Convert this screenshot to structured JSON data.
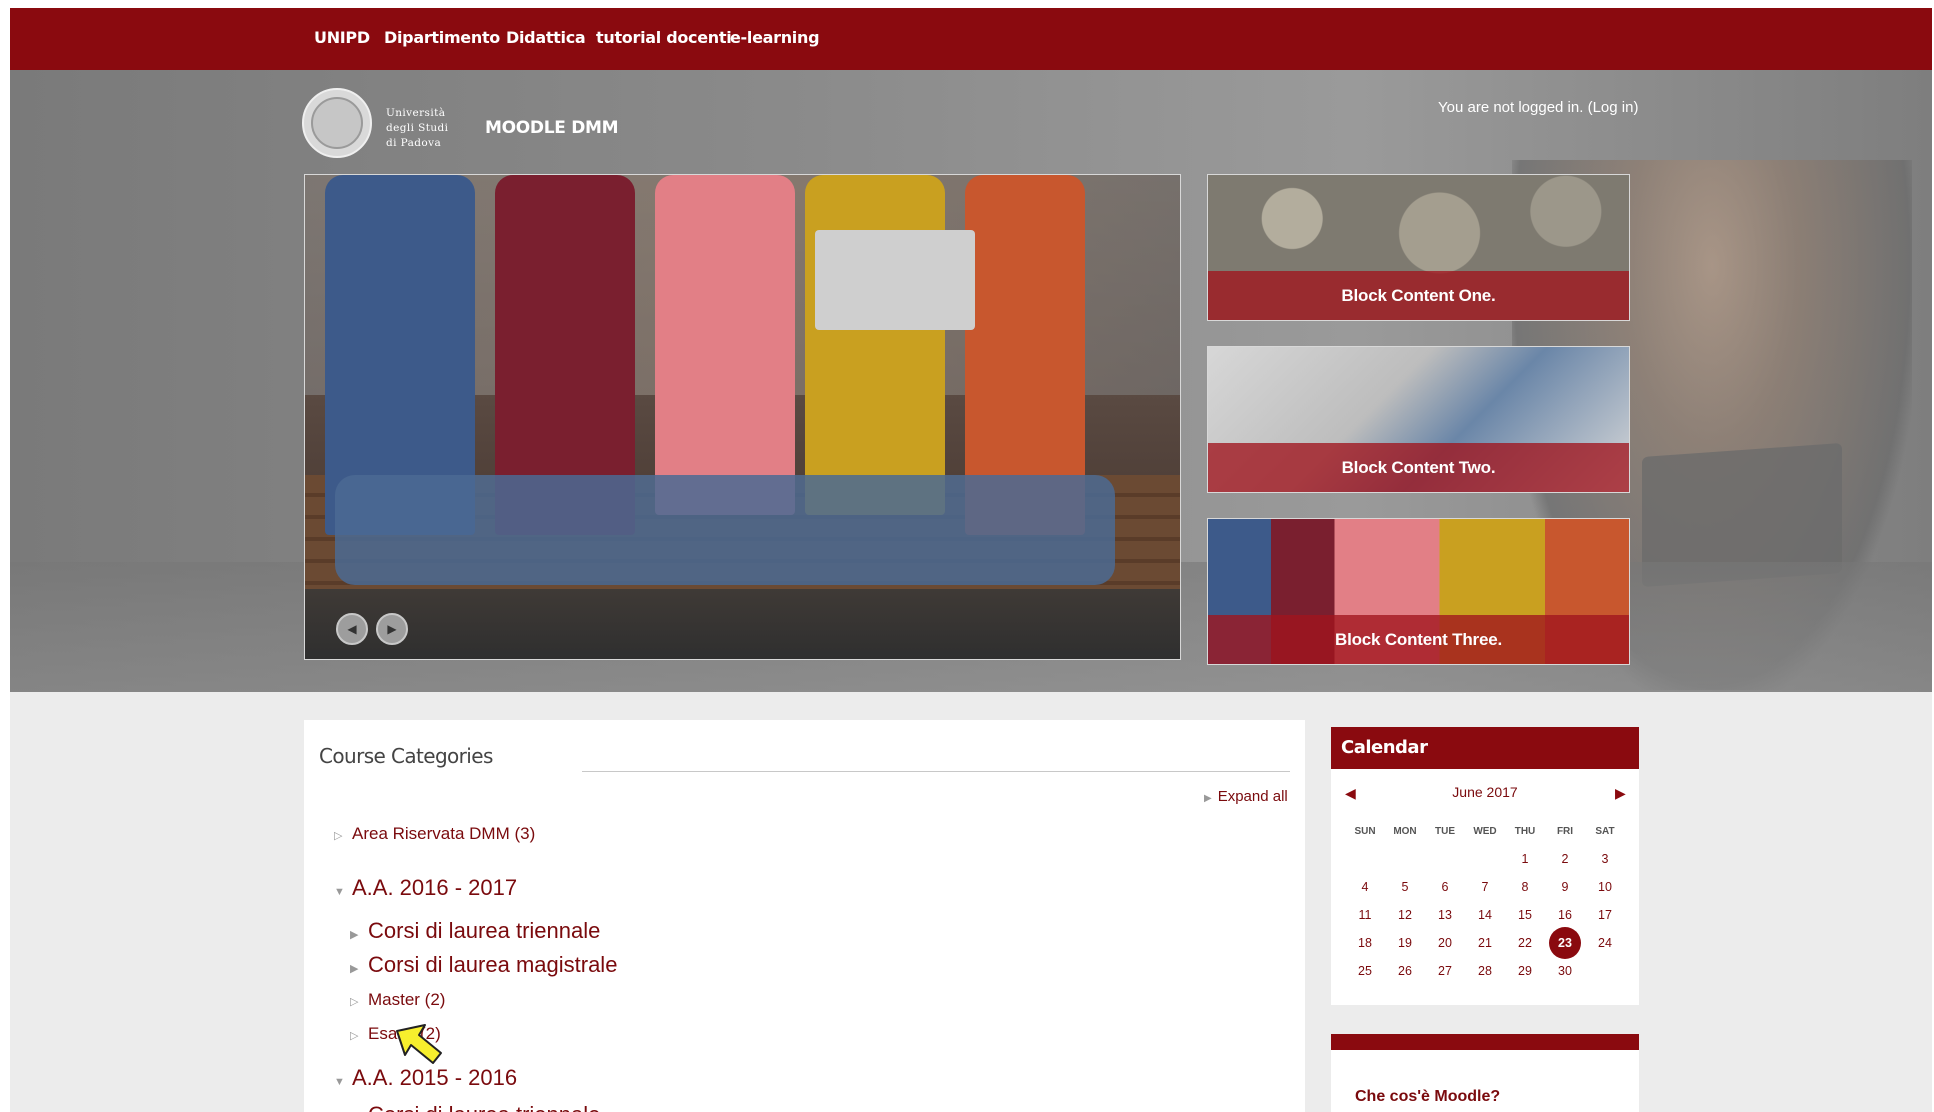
{
  "topnav": {
    "items": [
      "UNIPD",
      "Dipartimento",
      "Didattica",
      "tutorial docenti",
      "e-learning"
    ]
  },
  "header": {
    "logo_text": [
      "Università",
      "degli Studi",
      "di Padova"
    ],
    "site_name": "MOODLE DMM",
    "login_prefix": "You are not logged in. (",
    "login_link": "Log in",
    "login_suffix": ")"
  },
  "slider": {
    "prev_icon": "chevron-left-icon",
    "next_icon": "chevron-right-icon"
  },
  "blocks": [
    {
      "caption": "Block Content One."
    },
    {
      "caption": "Block Content Two."
    },
    {
      "caption": "Block Content Three."
    }
  ],
  "course_categories": {
    "title": "Course Categories",
    "expand_all": "Expand all",
    "items": [
      {
        "label": "Area Riservata DMM (3)"
      },
      {
        "label": "A.A. 2016 - 2017"
      },
      {
        "label": "Corsi di laurea triennale"
      },
      {
        "label": "Corsi di laurea magistrale"
      },
      {
        "label": "Master (2)"
      },
      {
        "label": "Esami (2)"
      },
      {
        "label": "A.A. 2015 - 2016"
      },
      {
        "label": "Corsi di laurea triennale"
      }
    ]
  },
  "calendar": {
    "title": "Calendar",
    "month": "June 2017",
    "days_of_week": [
      "SUN",
      "MON",
      "TUE",
      "WED",
      "THU",
      "FRI",
      "SAT"
    ],
    "weeks": [
      [
        "",
        "",
        "",
        "",
        "1",
        "2",
        "3"
      ],
      [
        "4",
        "5",
        "6",
        "7",
        "8",
        "9",
        "10"
      ],
      [
        "11",
        "12",
        "13",
        "14",
        "15",
        "16",
        "17"
      ],
      [
        "18",
        "19",
        "20",
        "21",
        "22",
        "23",
        "24"
      ],
      [
        "25",
        "26",
        "27",
        "28",
        "29",
        "30",
        ""
      ]
    ],
    "today": "23"
  },
  "moodle_block": {
    "title": "Che cos'è Moodle?"
  },
  "colors": {
    "brand": "#8a0a0f",
    "link": "#7a0a0d"
  }
}
